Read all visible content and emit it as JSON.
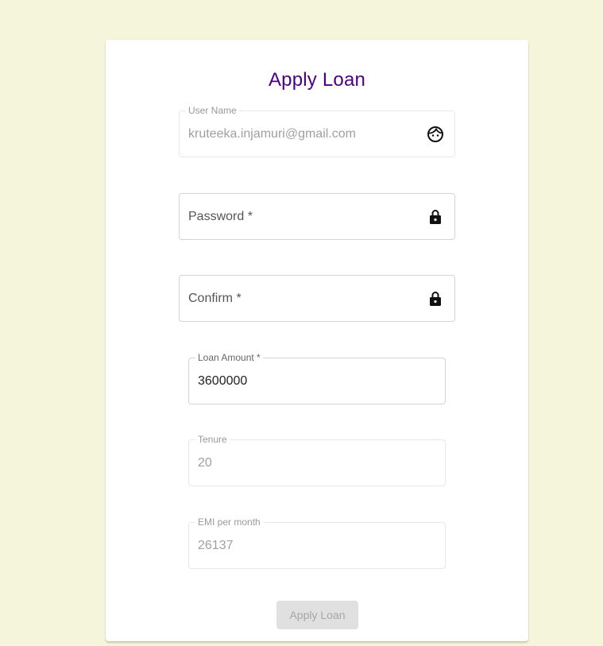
{
  "form": {
    "title": "Apply Loan",
    "username": {
      "label": "User Name",
      "value": "kruteeka.injamuri@gmail.com",
      "icon": "face-icon"
    },
    "password": {
      "placeholder": "Password *",
      "icon": "lock-icon"
    },
    "confirm": {
      "placeholder": "Confirm *",
      "icon": "lock-icon"
    },
    "loan_amount": {
      "label": "Loan Amount *",
      "value": "3600000"
    },
    "tenure": {
      "label": "Tenure",
      "value": "20"
    },
    "emi": {
      "label": "EMI per month",
      "value": "26137"
    },
    "submit_label": "Apply Loan"
  },
  "colors": {
    "page_background": "#f5f5dc",
    "title": "#4b0082",
    "button_disabled_bg": "#e0e0e0",
    "button_disabled_text": "#a6a6a6"
  }
}
